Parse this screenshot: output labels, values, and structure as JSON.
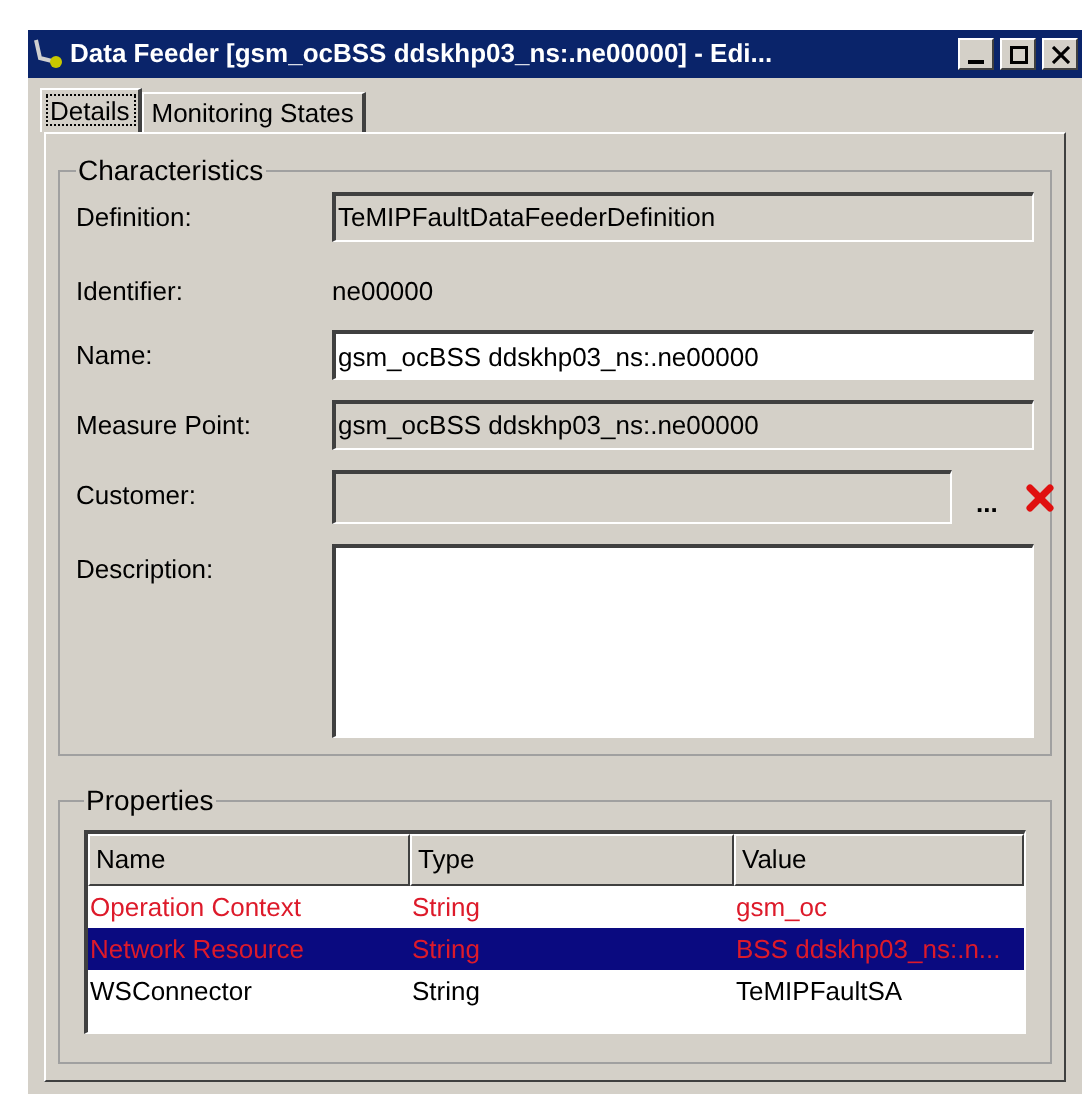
{
  "window": {
    "title": "Data Feeder [gsm_ocBSS ddskhp03_ns:.ne00000] - Edi..."
  },
  "tabs": [
    {
      "label": "Details",
      "selected": true
    },
    {
      "label": "Monitoring States",
      "selected": false
    }
  ],
  "characteristics": {
    "title": "Characteristics",
    "fields": [
      {
        "kind": "readonly",
        "label": "Definition:",
        "value": "TeMIPFaultDataFeederDefinition"
      },
      {
        "kind": "static",
        "label": "Identifier:",
        "value": "ne00000"
      },
      {
        "kind": "text",
        "label": "Name:",
        "value": "gsm_ocBSS ddskhp03_ns:.ne00000"
      },
      {
        "kind": "readonly",
        "label": "Measure Point:",
        "value": "gsm_ocBSS ddskhp03_ns:.ne00000"
      },
      {
        "kind": "lookup",
        "label": "Customer:",
        "browse": "..."
      },
      {
        "kind": "textarea",
        "label": "Description:"
      }
    ]
  },
  "properties": {
    "title": "Properties",
    "columns": [
      "Name",
      "Type",
      "Value"
    ],
    "rows": [
      {
        "cells": [
          "Operation Context",
          "String",
          "gsm_oc"
        ],
        "modified": true,
        "selected": false
      },
      {
        "cells": [
          "Network Resource",
          "String",
          "BSS ddskhp03_ns:.n..."
        ],
        "modified": true,
        "selected": true
      },
      {
        "cells": [
          "WSConnector",
          "String",
          "TeMIPFaultSA"
        ],
        "modified": false,
        "selected": false
      }
    ]
  }
}
